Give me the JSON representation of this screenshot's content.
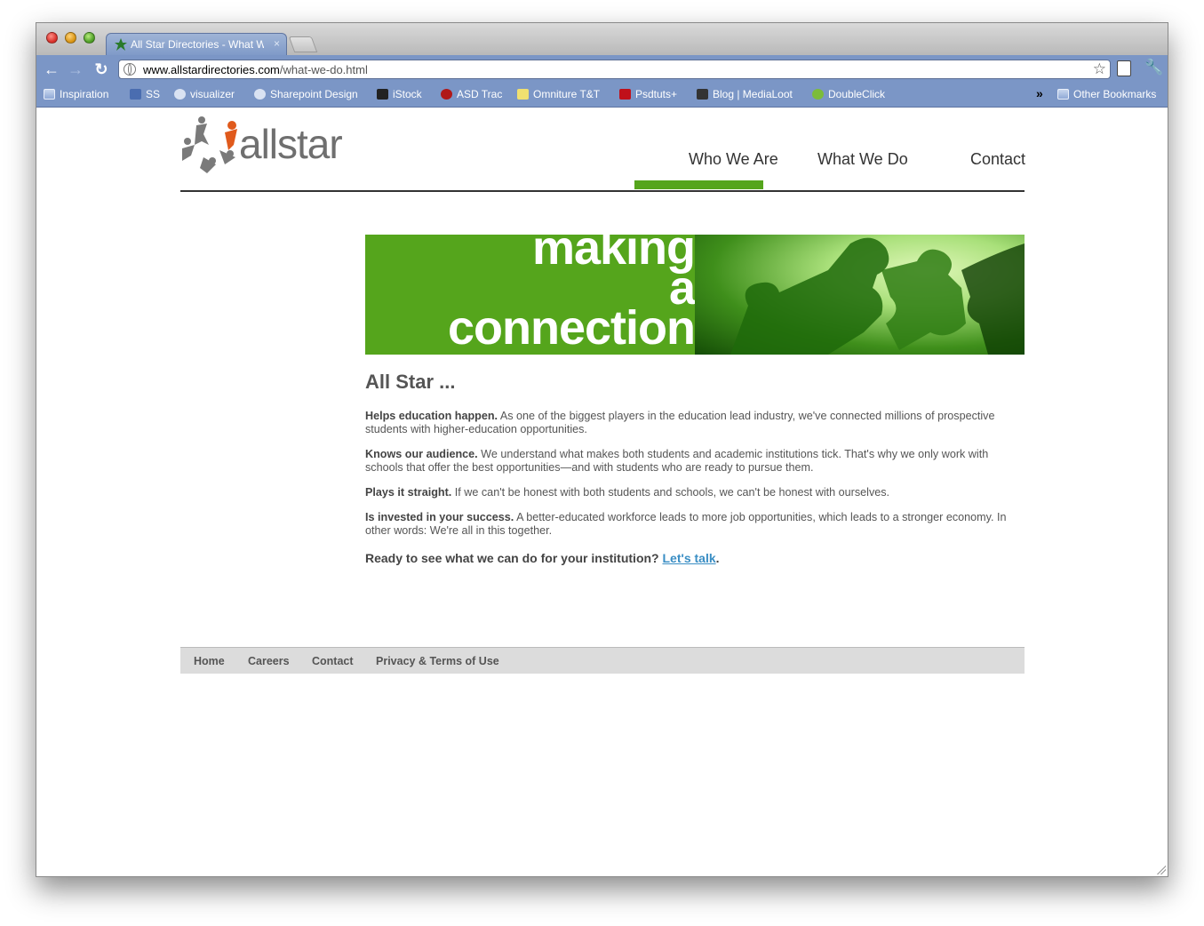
{
  "browser": {
    "tab_title": "All Star Directories - What We Do",
    "url_domain": "www.allstardirectories.com",
    "url_path": "/what-we-do.html",
    "bookmarks": [
      {
        "label": "Inspiration",
        "icon": "folder-icon"
      },
      {
        "label": "SS",
        "icon": "ss-icon"
      },
      {
        "label": "visualizer",
        "icon": "globe-icon"
      },
      {
        "label": "Sharepoint Design",
        "icon": "globe-icon"
      },
      {
        "label": "iStock",
        "icon": "istock-icon"
      },
      {
        "label": "ASD Trac",
        "icon": "trac-icon"
      },
      {
        "label": "Omniture T&T",
        "icon": "chart-icon"
      },
      {
        "label": "Psdtuts+",
        "icon": "psdtuts-icon"
      },
      {
        "label": "Blog | MediaLoot",
        "icon": "medialoot-icon"
      },
      {
        "label": "DoubleClick",
        "icon": "doubleclick-icon"
      }
    ],
    "overflow_label": "»",
    "other_bookmarks": "Other Bookmarks"
  },
  "site": {
    "logo_text": "allstar",
    "nav": {
      "who": "Who We Are",
      "what": "What We Do",
      "contact": "Contact"
    },
    "hero_lines": [
      "making",
      "a",
      "connection"
    ],
    "heading": "All Star ...",
    "paragraphs": [
      {
        "lead": "Helps education happen.",
        "body": " As one of the biggest players in the education lead industry, we've connected millions of prospective students with higher-education opportunities."
      },
      {
        "lead": "Knows our audience.",
        "body": " We understand what makes both students and academic institutions tick. That's why we only work with schools that offer the best opportunities—and with students who are ready to pursue them."
      },
      {
        "lead": "Plays it straight.",
        "body": " If we can't be honest with both students and schools, we can't be honest with ourselves."
      },
      {
        "lead": "Is invested in your success.",
        "body": " A better-educated workforce leads to more job opportunities, which leads to a stronger economy. In other words: We're all in this together."
      }
    ],
    "cta_text": "Ready to see what we can do for your institution? ",
    "cta_link": "Let's talk",
    "cta_end": ".",
    "footer": {
      "home": "Home",
      "careers": "Careers",
      "contact": "Contact",
      "privacy": "Privacy & Terms of Use"
    },
    "colors": {
      "brand_green": "#55a51c",
      "link": "#3a8ec4"
    }
  }
}
